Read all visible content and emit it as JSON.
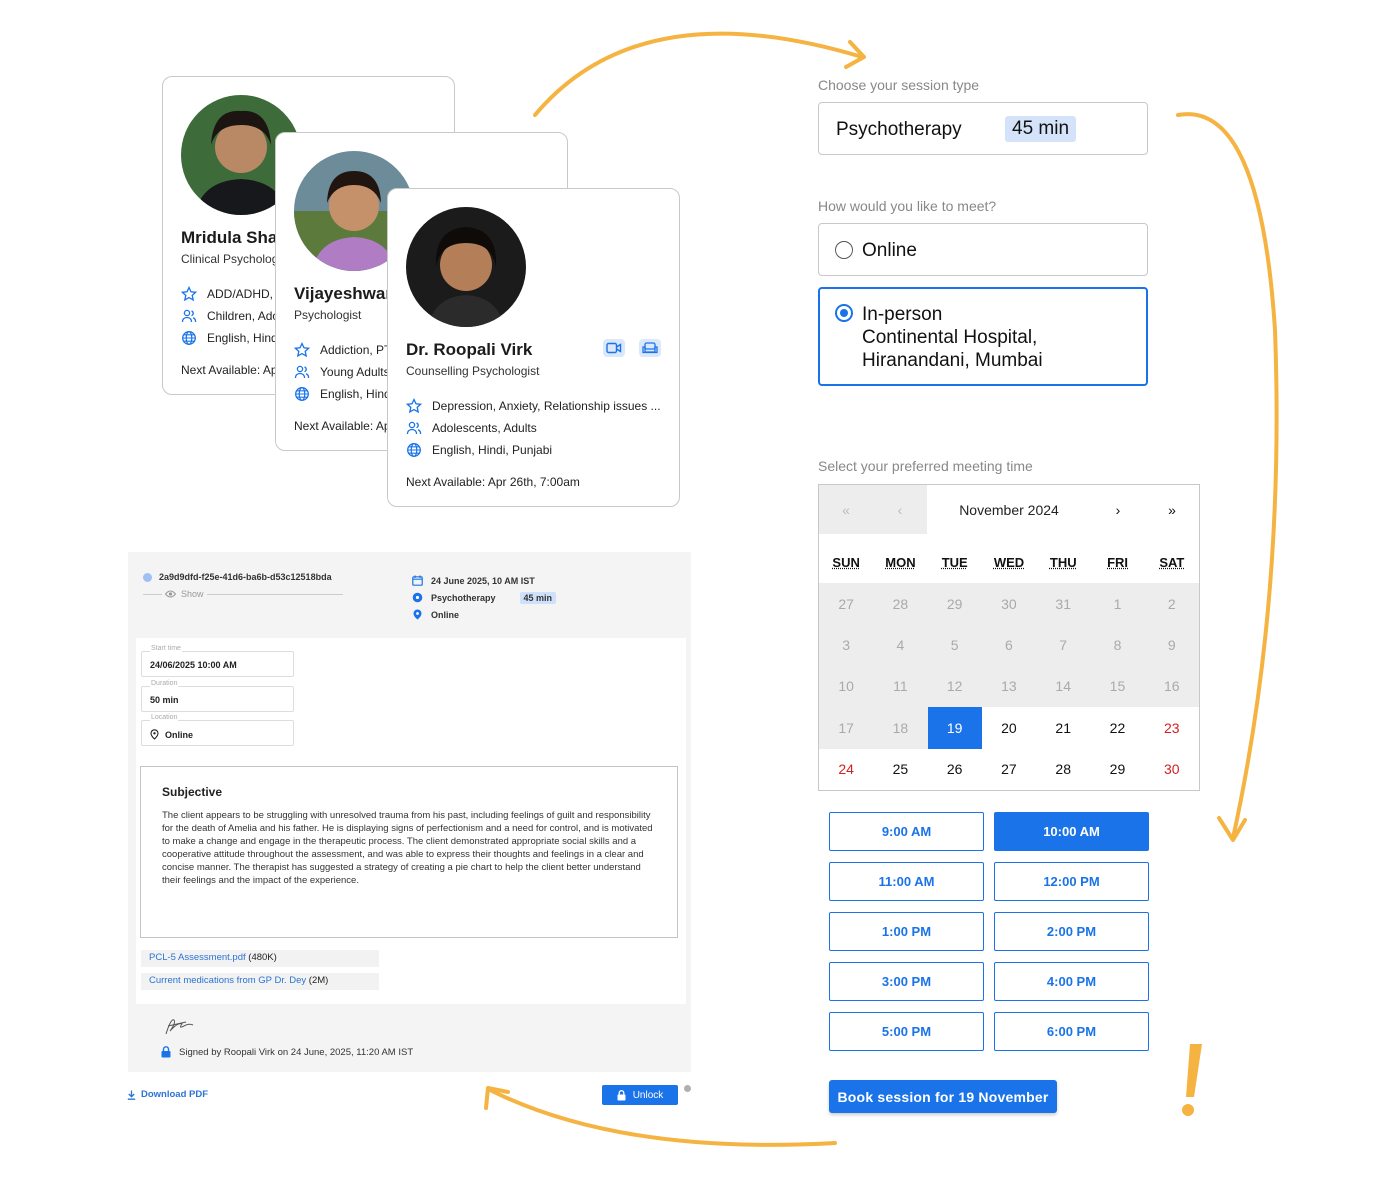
{
  "therapists": [
    {
      "name": "Mridula Sha",
      "role": "Clinical Psycholog",
      "specialties": "ADD/ADHD, A",
      "age_groups": "Children, Ado",
      "languages": "English, Hind",
      "next_available": "Next Available: Ap"
    },
    {
      "name": "Vijayeshwar",
      "role": "Psychologist",
      "specialties": "Addiction, PT",
      "age_groups": "Young Adults",
      "languages": "English, Hind",
      "next_available": "Next Available: Ap"
    },
    {
      "name": "Dr. Roopali Virk",
      "role": "Counselling Psychologist",
      "specialties": "Depression, Anxiety, Relationship issues ...",
      "age_groups": "Adolescents, Adults",
      "languages": "English, Hindi, Punjabi",
      "next_available": "Next Available: Apr 26th, 7:00am",
      "modes": [
        "video-icon",
        "sofa-icon"
      ]
    }
  ],
  "session_note": {
    "session_id": "2a9d9dfd-f25e-41d6-ba6b-d53c12518bda",
    "show_label": "Show",
    "date_time": "24 June 2025, 10 AM IST",
    "session_type": "Psychotherapy",
    "duration_badge": "45 min",
    "mode": "Online",
    "fields": {
      "start_label": "Start time",
      "start_value": "24/06/2025 10:00 AM",
      "duration_label": "Duration",
      "duration_value": "50 min",
      "location_label": "Location",
      "location_value": "Online"
    },
    "subjective_title": "Subjective",
    "subjective_text": "The client appears to be struggling with unresolved trauma from his past, including feelings of guilt and responsibility for the death of Amelia and his father. He is displaying signs of perfectionism and a need for control, and is motivated to make a change and engage in the therapeutic process. The client demonstrated appropriate social skills and a cooperative attitude throughout the assessment, and was able to express their thoughts and feelings in a clear and concise manner. The therapist has suggested a strategy of creating a pie chart to help the client better understand their feelings and the impact of the experience.",
    "attachments": [
      {
        "name": "PCL-5 Assessment.pdf",
        "size": "(480K)"
      },
      {
        "name": "Current medications from GP Dr. Dey",
        "size": "(2M)"
      }
    ],
    "signed_text": "Signed by Roopali Virk on 24 June, 2025, 11:20 AM IST",
    "download_label": "Download PDF",
    "unlock_label": "Unlock"
  },
  "booking": {
    "session_type_question": "Choose your session type",
    "session_type": "Psychotherapy",
    "session_duration": "45 min",
    "meet_question": "How would you like to meet?",
    "option_online": "Online",
    "option_inperson": "In-person",
    "inperson_line1": "Continental Hospital,",
    "inperson_line2": "Hiranandani, Mumbai",
    "selected_option": "In-person",
    "time_question": "Select your preferred meeting time",
    "calendar": {
      "month_label": "November 2024",
      "nav_prev_year": "«",
      "nav_prev": "‹",
      "nav_next": "›",
      "nav_next_year": "»",
      "weekdays": [
        "SUN",
        "MON",
        "TUE",
        "WED",
        "THU",
        "FRI",
        "SAT"
      ],
      "selected_day": "19"
    },
    "time_slots": [
      "9:00 AM",
      "10:00 AM",
      "11:00 AM",
      "12:00 PM",
      "1:00 PM",
      "2:00 PM",
      "3:00 PM",
      "4:00 PM",
      "5:00 PM",
      "6:00 PM"
    ],
    "selected_slot": "10:00 AM",
    "book_button": "Book session for 19 November"
  },
  "colors": {
    "accent": "#1a73e8",
    "arrow": "#f5b342",
    "weekend": "#d32020",
    "disabled": "#ededed"
  }
}
